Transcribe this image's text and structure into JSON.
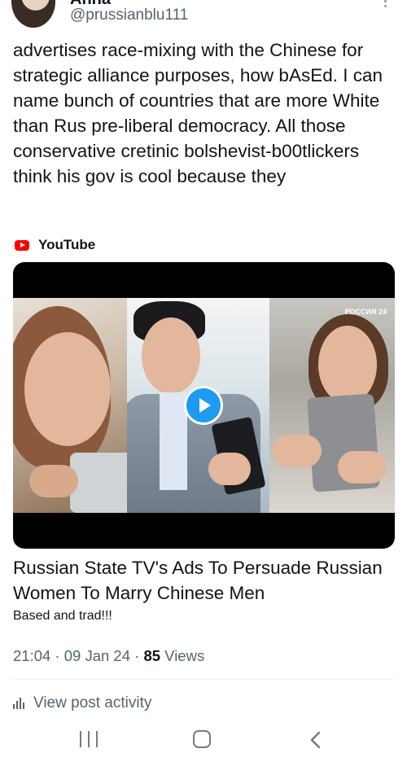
{
  "author": {
    "name": "Anna",
    "handle": "@prussianblu111"
  },
  "post": {
    "text": "advertises race-mixing with the Chinese for strategic alliance purposes, how bAsEd. I can name bunch of countries that are more White than Rus pre-liberal democracy. All those conservative cretinic bolshevist-b00tlickers think his gov is cool because they"
  },
  "embed": {
    "source": "YouTube",
    "channel_badge": "РОССИЯ 24",
    "title": "Russian State TV's Ads To Persuade Russian Women To Marry Chinese Men",
    "description": "Based and trad!!!"
  },
  "meta": {
    "time": "21:04",
    "sep1": " · ",
    "date": "09 Jan 24",
    "sep2": " · ",
    "views_count": "85",
    "views_label": " Views"
  },
  "activity": {
    "label": "View post activity"
  },
  "icons": {
    "play": "play-icon",
    "youtube": "youtube-icon",
    "more": "more-vertical-icon",
    "analytics": "analytics-icon"
  },
  "colors": {
    "accent": "#1d9bf0",
    "youtube_red": "#ff0000",
    "secondary_text": "#536471"
  }
}
